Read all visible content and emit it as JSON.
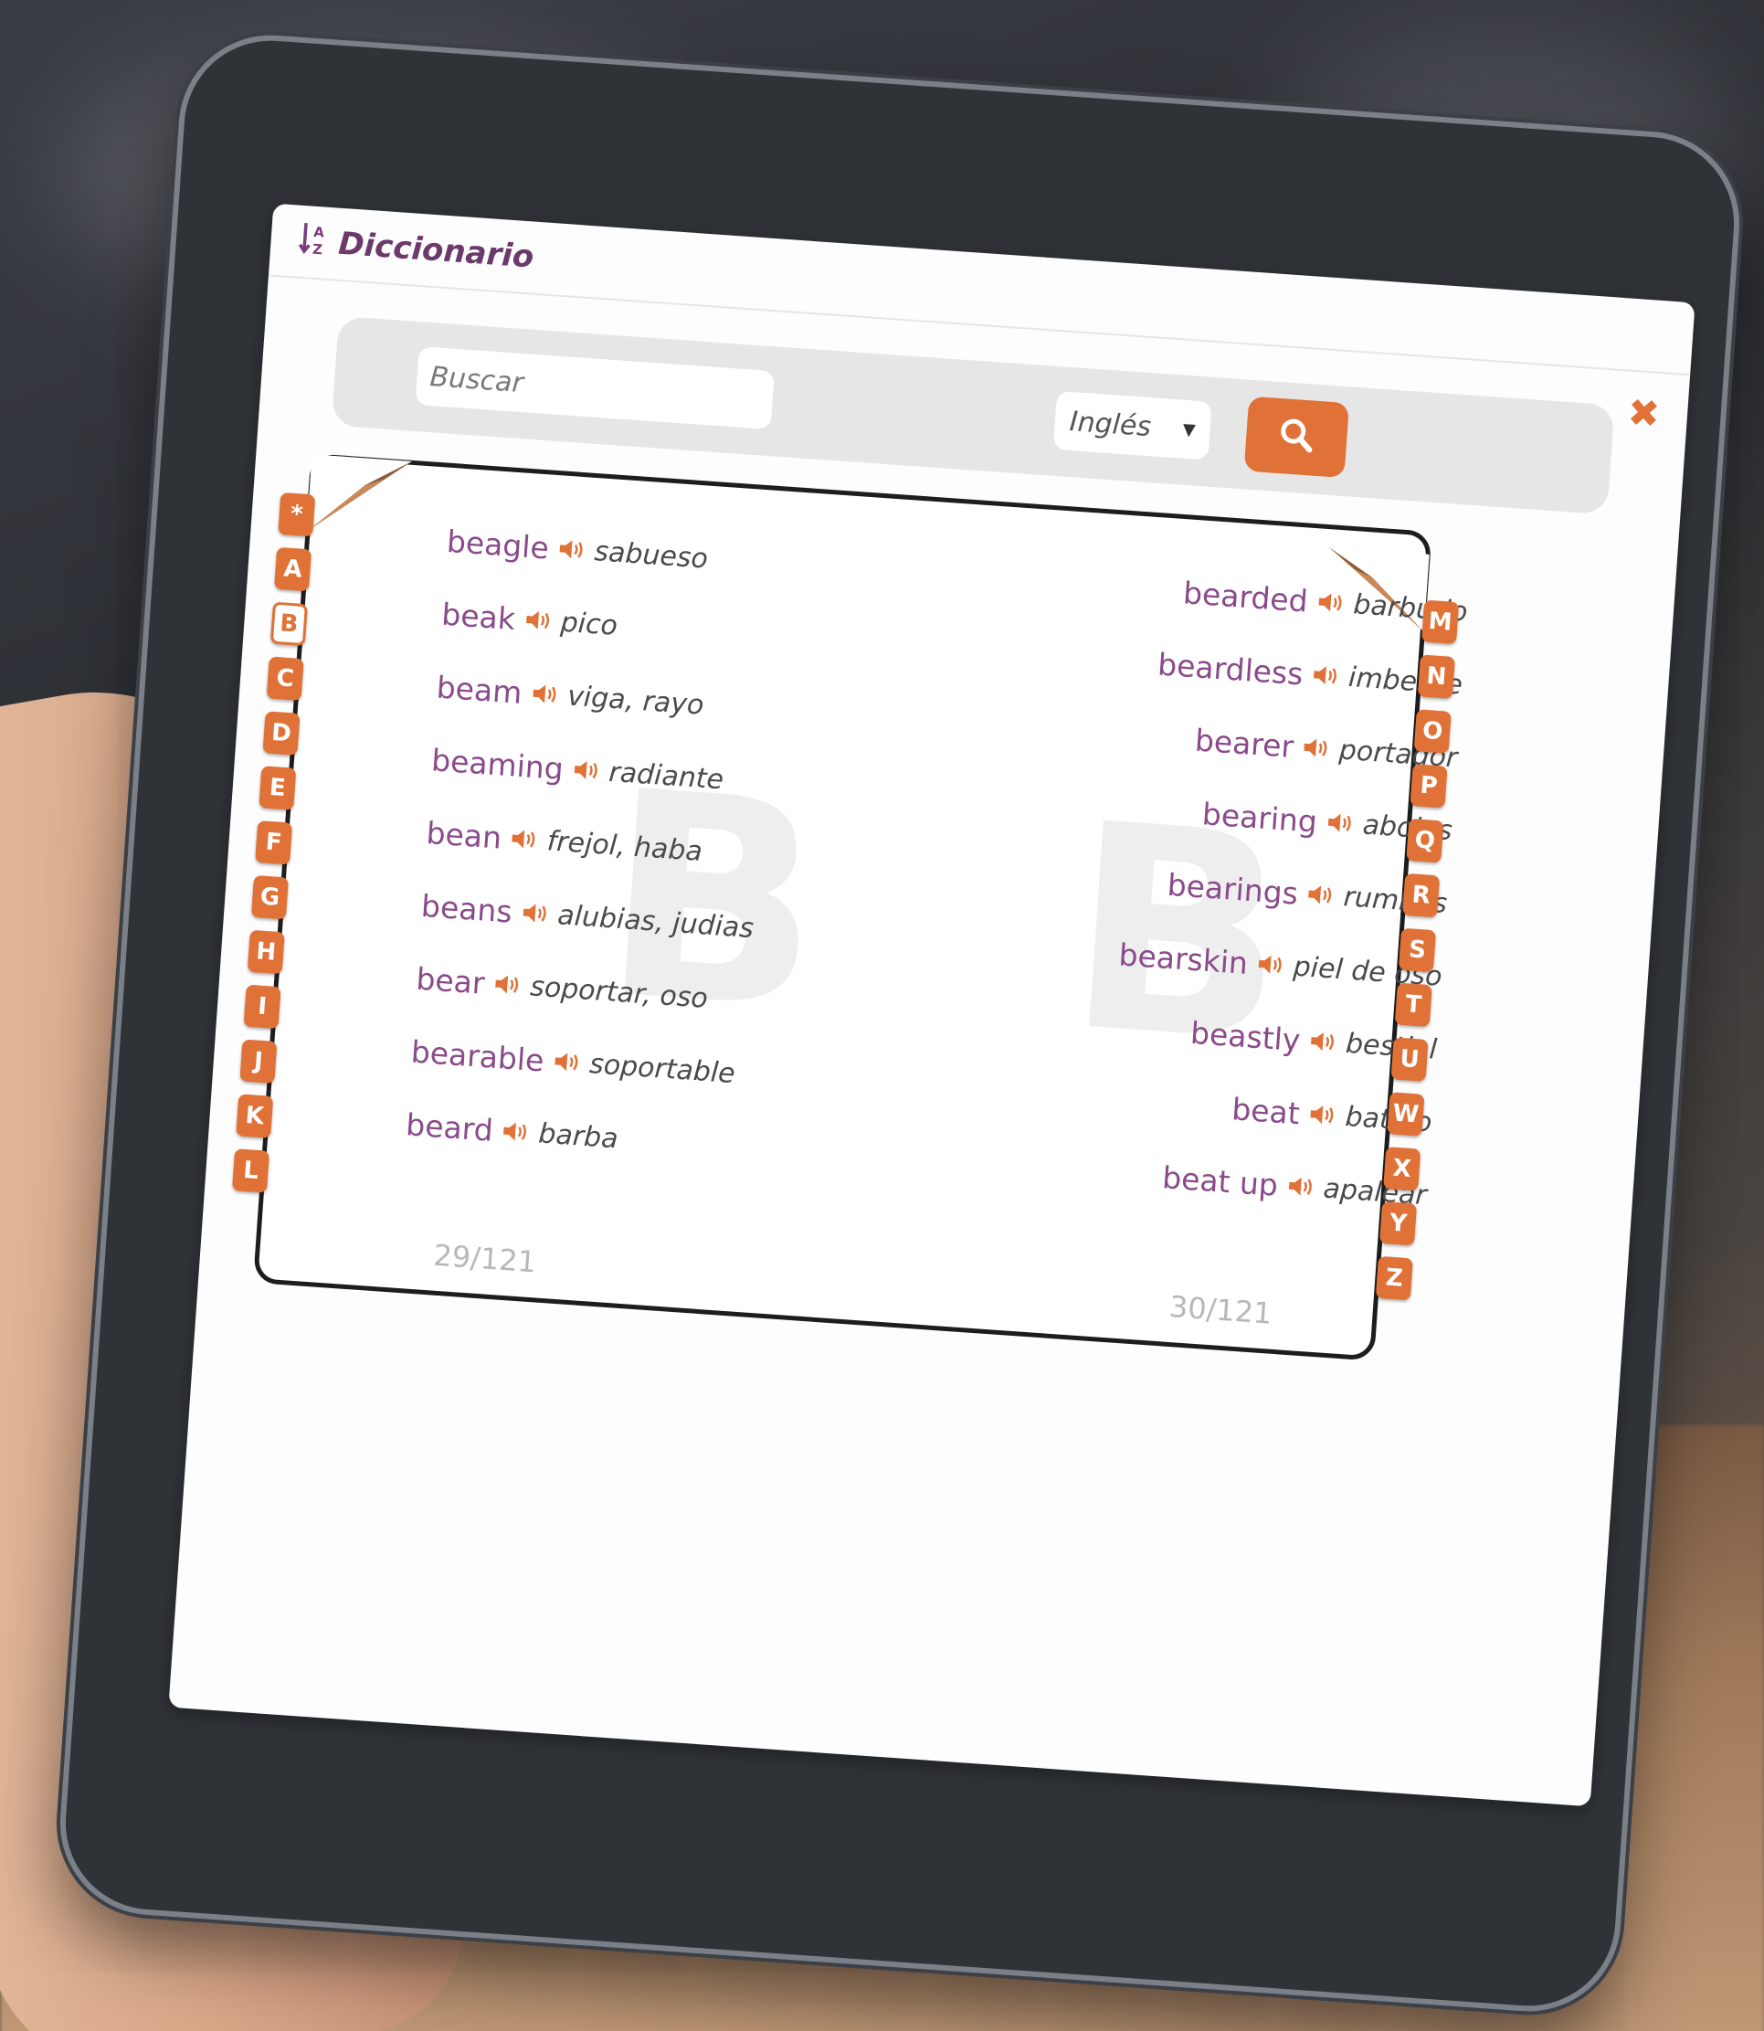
{
  "app": {
    "title": "Diccionario",
    "logo_icon": "sort-alpha-icon"
  },
  "search": {
    "placeholder": "Buscar",
    "value": ""
  },
  "language": {
    "selected": "Inglés"
  },
  "colors": {
    "accent": "#e07238",
    "word": "#8a4a8a",
    "title": "#6b3a6b"
  },
  "book": {
    "current_letter": "B",
    "left_page": {
      "watermark": "B",
      "page_number": "29/121",
      "entries": [
        {
          "word": "beagle",
          "translation": "sabueso"
        },
        {
          "word": "beak",
          "translation": "pico"
        },
        {
          "word": "beam",
          "translation": "viga, rayo"
        },
        {
          "word": "beaming",
          "translation": "radiante"
        },
        {
          "word": "bean",
          "translation": "frejol, haba"
        },
        {
          "word": "beans",
          "translation": "alubias, judias"
        },
        {
          "word": "bear",
          "translation": "soportar, oso"
        },
        {
          "word": "bearable",
          "translation": "soportable"
        },
        {
          "word": "beard",
          "translation": "barba"
        }
      ]
    },
    "right_page": {
      "watermark": "B",
      "page_number": "30/121",
      "entries": [
        {
          "word": "bearded",
          "translation": "barbudo"
        },
        {
          "word": "beardless",
          "translation": "imberbe"
        },
        {
          "word": "bearer",
          "translation": "portador"
        },
        {
          "word": "bearing",
          "translation": "abolas"
        },
        {
          "word": "bearings",
          "translation": "rumbos"
        },
        {
          "word": "bearskin",
          "translation": "piel de oso"
        },
        {
          "word": "beastly",
          "translation": "bestial"
        },
        {
          "word": "beat",
          "translation": "batido"
        },
        {
          "word": "beat up",
          "translation": "apalear"
        }
      ]
    }
  },
  "tabs_left": [
    "*",
    "A",
    "B",
    "C",
    "D",
    "E",
    "F",
    "G",
    "H",
    "I",
    "J",
    "K",
    "L"
  ],
  "tabs_right": [
    "M",
    "N",
    "O",
    "P",
    "Q",
    "R",
    "S",
    "T",
    "U",
    "W",
    "X",
    "Y",
    "Z"
  ]
}
